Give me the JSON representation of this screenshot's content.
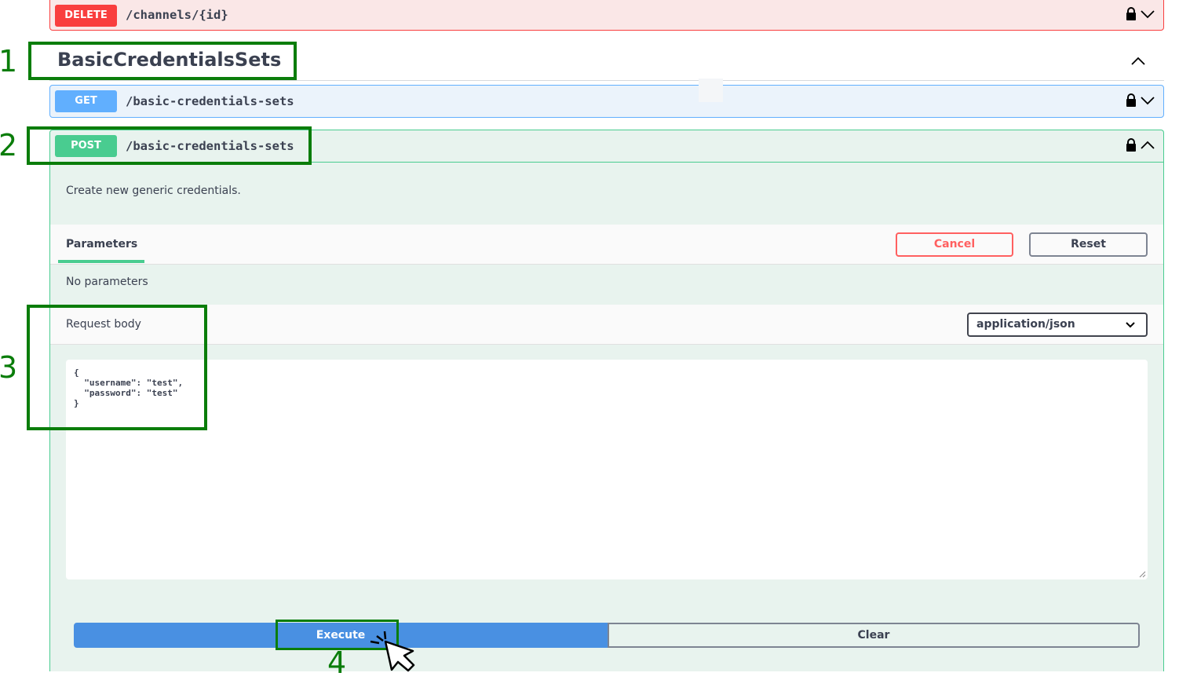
{
  "operations": {
    "delete": {
      "method": "DELETE",
      "path": "/channels/{id}"
    },
    "get": {
      "method": "GET",
      "path": "/basic-credentials-sets"
    },
    "post": {
      "method": "POST",
      "path": "/basic-credentials-sets",
      "description": "Create new generic credentials.",
      "tab_label": "Parameters",
      "cancel_label": "Cancel",
      "reset_label": "Reset",
      "no_params": "No parameters",
      "request_body_label": "Request body",
      "content_type": "application/json",
      "body_text": "{\n  \"username\": \"test\",\n  \"password\": \"test\"\n}",
      "execute_label": "Execute",
      "clear_label": "Clear"
    }
  },
  "tag": {
    "title": "BasicCredentialsSets"
  },
  "annotations": {
    "one": "1",
    "two": "2",
    "three": "3",
    "four": "4"
  },
  "colors": {
    "delete": "#f93e3e",
    "get": "#61affe",
    "post": "#49cc90",
    "execute": "#4990e2",
    "annotation": "#0a7d0a",
    "cancel": "#ff6060"
  },
  "icons": [
    "lock-icon",
    "chevron-down-icon",
    "chevron-up-icon",
    "cursor-pointer-icon",
    "resize-handle-icon"
  ]
}
